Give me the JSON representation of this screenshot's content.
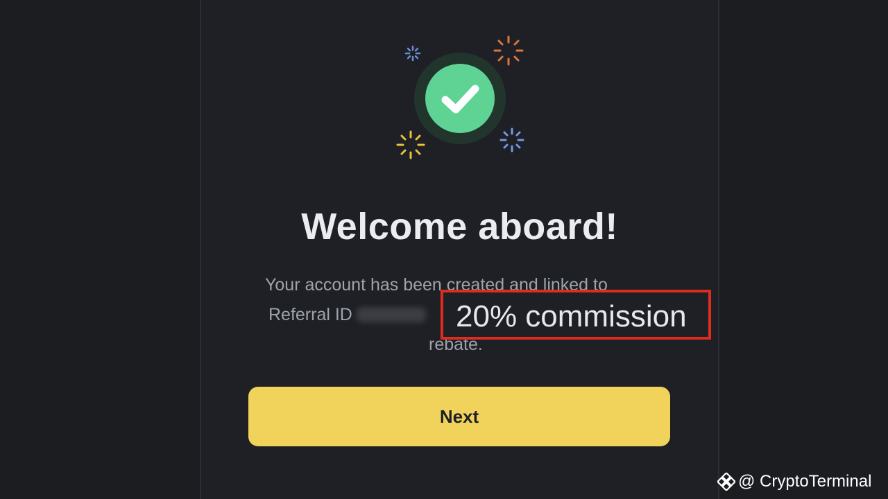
{
  "dialog": {
    "title": "Welcome aboard!",
    "message_line1": "Your account has been created and linked to",
    "message_line2_prefix": "Referral ID",
    "message_line3": "rebate.",
    "highlight_text": "20% commission"
  },
  "actions": {
    "next_label": "Next"
  },
  "watermark": {
    "text": "@ CryptoTerminal"
  },
  "colors": {
    "background": "#1c1d21",
    "panel": "#1e2025",
    "accent_yellow": "#f1d35c",
    "success_green": "#5fd394",
    "highlight_red": "#e02b1f"
  },
  "icons": {
    "success": "check-circle-icon",
    "sparkles": [
      "sparkle-icon-blue",
      "sparkle-icon-orange",
      "sparkle-icon-yellow",
      "sparkle-icon-blue"
    ],
    "watermark_logo": "binance-logo-icon"
  }
}
